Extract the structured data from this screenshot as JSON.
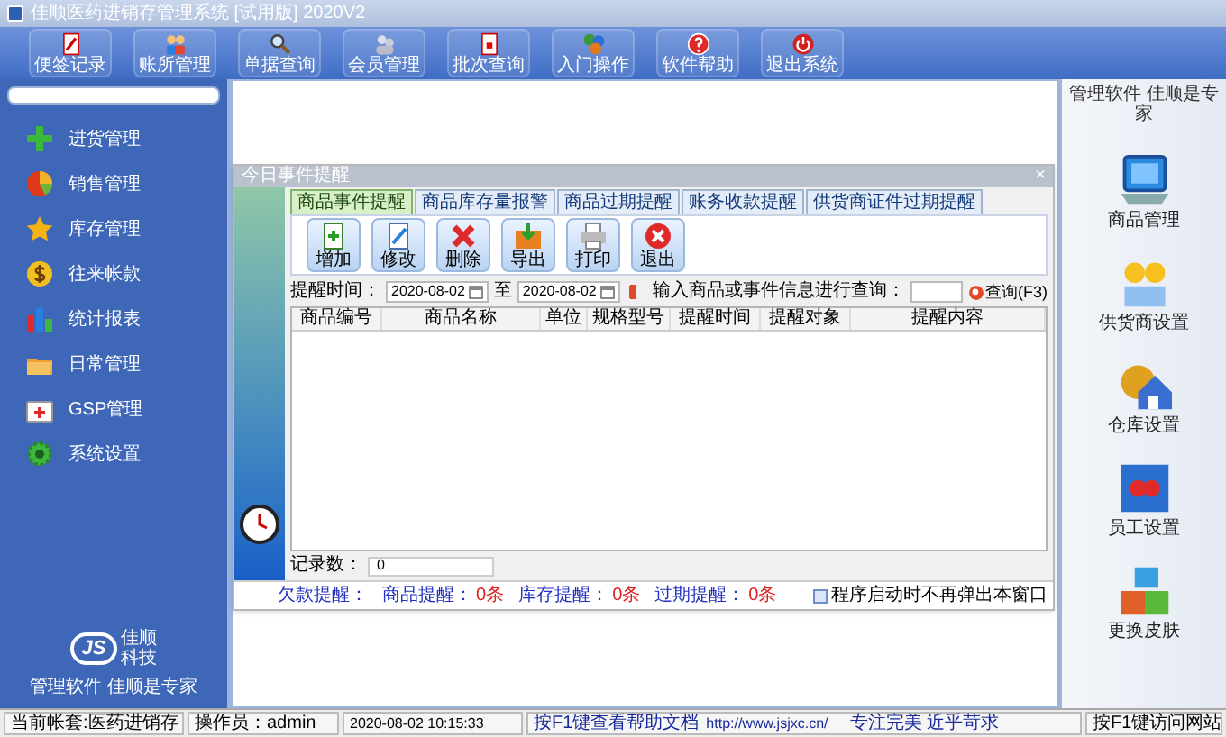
{
  "window": {
    "title": "佳顺医药进销存管理系统 [试用版] 2020V2"
  },
  "toolbar": [
    {
      "label": "便签记录"
    },
    {
      "label": "账所管理"
    },
    {
      "label": "单据查询"
    },
    {
      "label": "会员管理"
    },
    {
      "label": "批次查询"
    },
    {
      "label": "入门操作"
    },
    {
      "label": "软件帮助"
    },
    {
      "label": "退出系统"
    }
  ],
  "sidebar": {
    "items": [
      {
        "label": "进货管理"
      },
      {
        "label": "销售管理"
      },
      {
        "label": "库存管理"
      },
      {
        "label": "往来帐款"
      },
      {
        "label": "统计报表"
      },
      {
        "label": "日常管理"
      },
      {
        "label": "GSP管理"
      },
      {
        "label": "系统设置"
      }
    ],
    "logo": {
      "mark": "JS",
      "name_1": "佳顺",
      "name_2": "科技",
      "slogan": "管理软件 佳顺是专家"
    }
  },
  "dialog": {
    "title": "今日事件提醒",
    "close": "×",
    "tabs": [
      {
        "label": "商品事件提醒",
        "selected": true
      },
      {
        "label": "商品库存量报警",
        "selected": false
      },
      {
        "label": "商品过期提醒",
        "selected": false
      },
      {
        "label": "账务收款提醒",
        "selected": false
      },
      {
        "label": "供货商证件过期提醒",
        "selected": false
      }
    ],
    "buttons": [
      {
        "label": "增加"
      },
      {
        "label": "修改"
      },
      {
        "label": "删除"
      },
      {
        "label": "导出"
      },
      {
        "label": "打印"
      },
      {
        "label": "退出"
      }
    ],
    "filter": {
      "time_label": "提醒时间：",
      "date_from": "2020-08-02",
      "to_label": "至",
      "date_to": "2020-08-02",
      "search_label": "输入商品或事件信息进行查询：",
      "search_button": "查询(F3)"
    },
    "table": {
      "columns": [
        "商品编号",
        "商品名称",
        "单位",
        "规格型号",
        "提醒时间",
        "提醒对象",
        "提醒内容"
      ]
    },
    "record_label": "记录数：",
    "record_count": "0",
    "footer": {
      "debt_label": "欠款提醒：",
      "goods_label": "商品提醒：",
      "goods_count": "0条",
      "stock_label": "库存提醒：",
      "stock_count": "0条",
      "expiry_label": "过期提醒：",
      "expiry_count": "0条",
      "no_popup": {
        "label": "程序启动时不再弹出本窗口",
        "checked": false
      }
    }
  },
  "right_panel": {
    "caption": "管理软件 佳顺是专家",
    "items": [
      {
        "label": "商品管理"
      },
      {
        "label": "供货商设置"
      },
      {
        "label": "仓库设置"
      },
      {
        "label": "员工设置"
      },
      {
        "label": "更换皮肤"
      }
    ]
  },
  "status_bar": {
    "account": "当前帐套:医药进销存",
    "operator": "操作员：admin",
    "datetime": "2020-08-02 10:15:33",
    "help": "按F1键查看帮助文档",
    "url": "http://www.jsjxc.cn/",
    "motto": "专注完美 近乎苛求",
    "website": "按F1键访问网站"
  }
}
